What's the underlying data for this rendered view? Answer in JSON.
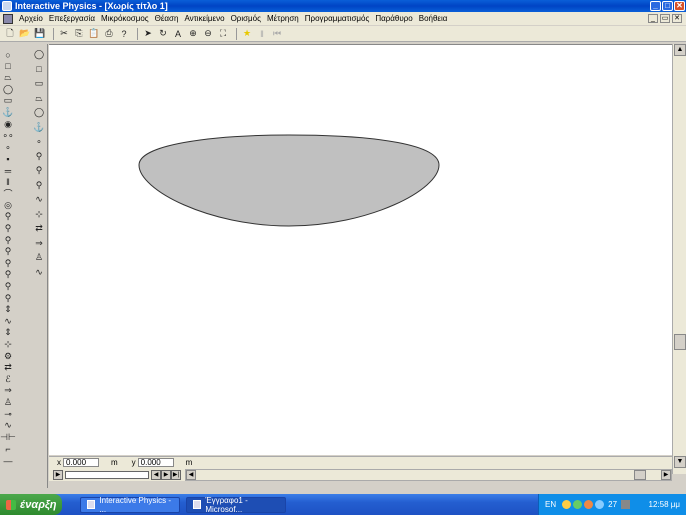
{
  "window": {
    "title": "Interactive Physics - [Χωρίς τίτλο 1]",
    "controls": [
      "_",
      "□",
      "✕"
    ]
  },
  "menubar": {
    "items": [
      "Αρχείο",
      "Επεξεργασία",
      "Μικρόκοσμος",
      "Θέαση",
      "Αντικείμενο",
      "Ορισμός",
      "Μέτρηση",
      "Προγραμματισμός",
      "Παράθυρο",
      "Βοήθεια"
    ],
    "mdi_controls": [
      "_",
      "▭",
      "✕"
    ]
  },
  "toolbar": {
    "buttons": [
      {
        "icon": "new-file-icon",
        "glyph": "🗋"
      },
      {
        "icon": "open-folder-icon",
        "glyph": "📂"
      },
      {
        "icon": "save-icon",
        "glyph": "💾"
      },
      {
        "icon": "cut-icon",
        "glyph": "✂"
      },
      {
        "icon": "copy-icon",
        "glyph": "⎘"
      },
      {
        "icon": "paste-icon",
        "glyph": "📋"
      },
      {
        "icon": "print-icon",
        "glyph": "⎙"
      },
      {
        "icon": "help-icon",
        "glyph": "?"
      },
      {
        "icon": "arrow-pointer-icon",
        "glyph": "➤"
      },
      {
        "icon": "rotate-icon",
        "glyph": "↻"
      },
      {
        "icon": "text-icon",
        "glyph": "A"
      },
      {
        "icon": "zoom-in-icon",
        "glyph": "⊕"
      },
      {
        "icon": "zoom-out-icon",
        "glyph": "⊖"
      },
      {
        "icon": "zoom-fit-icon",
        "glyph": "⛶"
      },
      {
        "icon": "run-icon",
        "glyph": "★"
      },
      {
        "icon": "stop-icon",
        "glyph": "‖"
      },
      {
        "icon": "reset-icon",
        "glyph": "⏮"
      }
    ]
  },
  "palette": {
    "left": [
      "○",
      "□",
      "⏢",
      "◯",
      "▭",
      "⚓",
      "◉",
      "∘∘",
      "∘",
      "▪",
      "═",
      "‖",
      "⌒",
      "◎",
      "⚲",
      "⚲",
      "⚲",
      "⚲",
      "⚲",
      "⚲",
      "⚲",
      "⚲",
      "⇕",
      "∿",
      "⇕",
      "⊹",
      "⚙",
      "⇄",
      "ℰ",
      "⇒",
      "♙",
      "⊸",
      "∿",
      "⊣⊢",
      "⌐",
      "—"
    ],
    "right": [
      "◯",
      "□",
      "▭",
      "⏢",
      "◯",
      "⚓",
      "∘",
      "⚲",
      "⚲",
      "⚲",
      "∿",
      "⊹",
      "⇄",
      "⇒",
      "♙",
      "∿"
    ]
  },
  "canvas": {
    "object": "ellipse-body",
    "fill": "#c0c0c0"
  },
  "coords": {
    "x_label": "x",
    "x_value": "0.000",
    "x_unit": "m",
    "y_label": "y",
    "y_value": "0.000",
    "y_unit": "m"
  },
  "taskbar": {
    "start_label": "έναρξη",
    "tasks": [
      "Interactive Physics - ...",
      "Έγγραφο1 - Microsof..."
    ],
    "lang": "EN",
    "temperature": "27",
    "clock": "12:58 μμ"
  }
}
